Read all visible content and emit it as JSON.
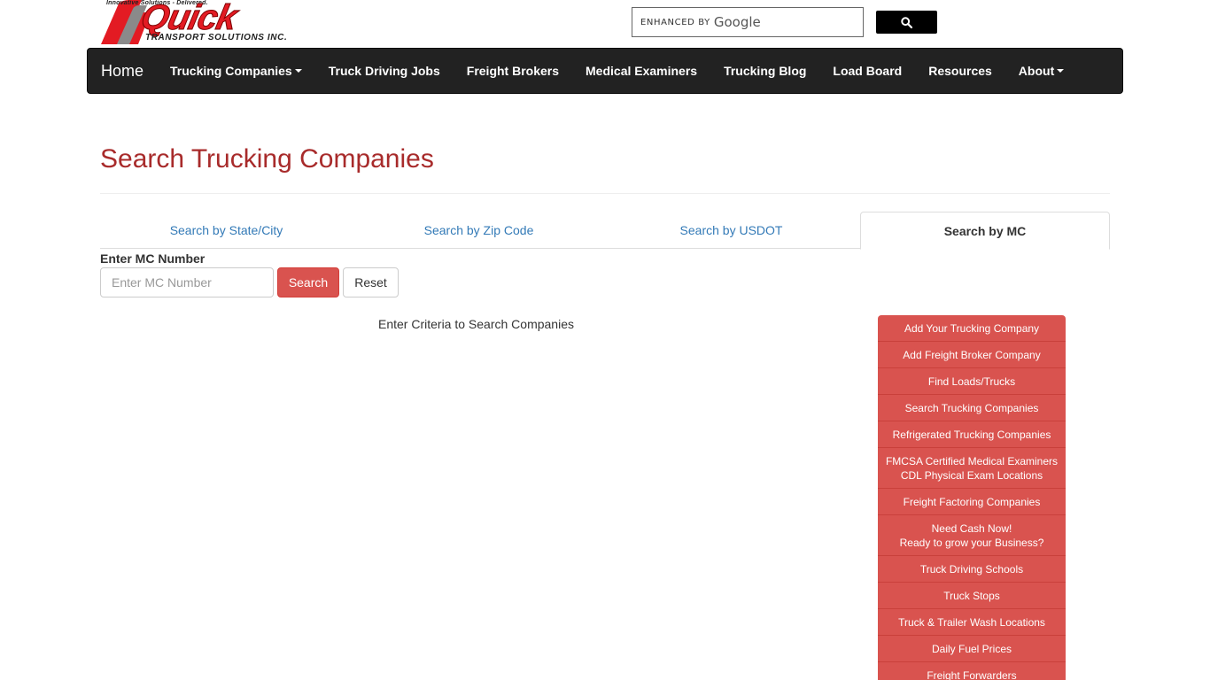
{
  "logo": {
    "tagline": "Innovative Solutions - Delivered.",
    "word": "Quick",
    "sub": "TRANSPORT SOLUTIONS INC.",
    "brand_color": "#e31b23"
  },
  "google_search": {
    "enhanced_by": "ENHANCED BY",
    "google": "Google",
    "button_icon": "search-icon"
  },
  "nav": {
    "home": "Home",
    "items": [
      {
        "label": "Trucking Companies",
        "dropdown": true
      },
      {
        "label": "Truck Driving Jobs",
        "dropdown": false
      },
      {
        "label": "Freight Brokers",
        "dropdown": false
      },
      {
        "label": "Medical Examiners",
        "dropdown": false
      },
      {
        "label": "Trucking Blog",
        "dropdown": false
      },
      {
        "label": "Load Board",
        "dropdown": false
      },
      {
        "label": "Resources",
        "dropdown": false
      },
      {
        "label": "About",
        "dropdown": true
      }
    ]
  },
  "page": {
    "title": "Search Trucking Companies"
  },
  "tabs": [
    {
      "label": "Search by State/City",
      "active": false
    },
    {
      "label": "Search by Zip Code",
      "active": false
    },
    {
      "label": "Search by USDOT",
      "active": false
    },
    {
      "label": "Search by MC",
      "active": true
    }
  ],
  "form": {
    "label": "Enter MC Number",
    "placeholder": "Enter MC Number",
    "value": "",
    "search_label": "Search",
    "reset_label": "Reset"
  },
  "results": {
    "message": "Enter Criteria to Search Companies"
  },
  "side_menu": [
    {
      "line1": "Add Your Trucking Company",
      "line2": ""
    },
    {
      "line1": "Add Freight Broker Company",
      "line2": ""
    },
    {
      "line1": "Find Loads/Trucks",
      "line2": ""
    },
    {
      "line1": "Search Trucking Companies",
      "line2": ""
    },
    {
      "line1": "Refrigerated Trucking Companies",
      "line2": ""
    },
    {
      "line1": "FMCSA Certified Medical Examiners",
      "line2": "CDL Physical Exam Locations"
    },
    {
      "line1": "Freight Factoring Companies",
      "line2": ""
    },
    {
      "line1": "Need Cash Now!",
      "line2": "Ready to grow your Business?"
    },
    {
      "line1": "Truck Driving Schools",
      "line2": ""
    },
    {
      "line1": "Truck Stops",
      "line2": ""
    },
    {
      "line1": "Truck & Trailer Wash Locations",
      "line2": ""
    },
    {
      "line1": "Daily Fuel Prices",
      "line2": ""
    },
    {
      "line1": "Freight Forwarders",
      "line2": ""
    }
  ],
  "colors": {
    "accent_red": "#d9534f",
    "title_red": "#a82b2b",
    "navbar": "#222222",
    "link_blue": "#337ab7"
  }
}
